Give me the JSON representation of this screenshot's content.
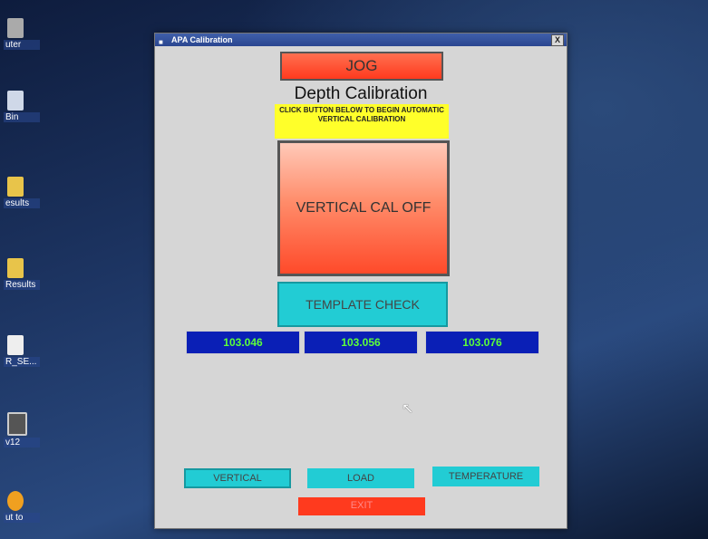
{
  "desktop": {
    "icons": [
      {
        "label": "uter"
      },
      {
        "label": "Bin"
      },
      {
        "label": "esults"
      },
      {
        "label": "Results"
      },
      {
        "label": "R_SE..."
      },
      {
        "label": "v12"
      },
      {
        "label": "ut to"
      }
    ]
  },
  "window": {
    "title": "APA Calibration",
    "close_label": "X"
  },
  "main": {
    "jog_label": "JOG",
    "heading": "Depth Calibration",
    "notice": "CLICK BUTTON BELOW TO BEGIN AUTOMATIC VERTICAL CALIBRATION",
    "vertical_cal_label": "VERTICAL CAL OFF",
    "template_check_label": "TEMPLATE CHECK",
    "readouts": [
      "103.046",
      "103.056",
      "103.076"
    ]
  },
  "footer": {
    "vertical_label": "VERTICAL",
    "load_label": "LOAD",
    "temperature_label": "TEMPERATURE",
    "exit_label": "EXIT"
  },
  "colors": {
    "button_red": "#ff3a1e",
    "button_cyan": "#22ccd4",
    "readout_bg": "#0a1fb6",
    "readout_text": "#5cff3a",
    "notice_bg": "#ffff2a"
  }
}
